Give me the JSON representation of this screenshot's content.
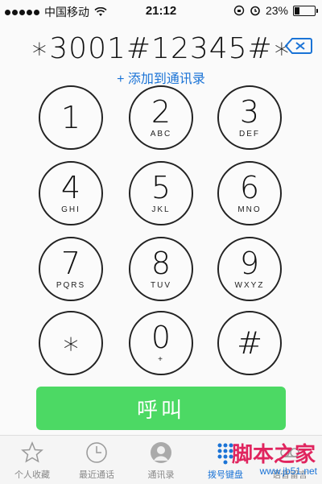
{
  "status_bar": {
    "carrier": "中国移动",
    "time": "21:12",
    "battery_percent": "23%",
    "battery_level": 0.23
  },
  "dialer": {
    "number": "∗3001#12345#∗",
    "add_contact_label": "+ 添加到通讯录"
  },
  "keypad": {
    "keys": [
      {
        "digit": "1",
        "letters": ""
      },
      {
        "digit": "2",
        "letters": "ABC"
      },
      {
        "digit": "3",
        "letters": "DEF"
      },
      {
        "digit": "4",
        "letters": "GHI"
      },
      {
        "digit": "5",
        "letters": "JKL"
      },
      {
        "digit": "6",
        "letters": "MNO"
      },
      {
        "digit": "7",
        "letters": "PQRS"
      },
      {
        "digit": "8",
        "letters": "TUV"
      },
      {
        "digit": "9",
        "letters": "WXYZ"
      },
      {
        "digit": "∗",
        "letters": ""
      },
      {
        "digit": "0",
        "letters": "+"
      },
      {
        "digit": "#",
        "letters": ""
      }
    ]
  },
  "call_button": {
    "label": "呼叫"
  },
  "tabs": [
    {
      "label": "个人收藏",
      "icon": "star-icon"
    },
    {
      "label": "最近通话",
      "icon": "clock-icon"
    },
    {
      "label": "通讯录",
      "icon": "contact-icon"
    },
    {
      "label": "拨号键盘",
      "icon": "keypad-icon"
    },
    {
      "label": "语音留言",
      "icon": "voicemail-icon"
    }
  ],
  "watermark": {
    "text": "脚本之家",
    "url": "www.jb51.net"
  },
  "colors": {
    "accent": "#1a73d6",
    "call_green": "#4cd964"
  }
}
